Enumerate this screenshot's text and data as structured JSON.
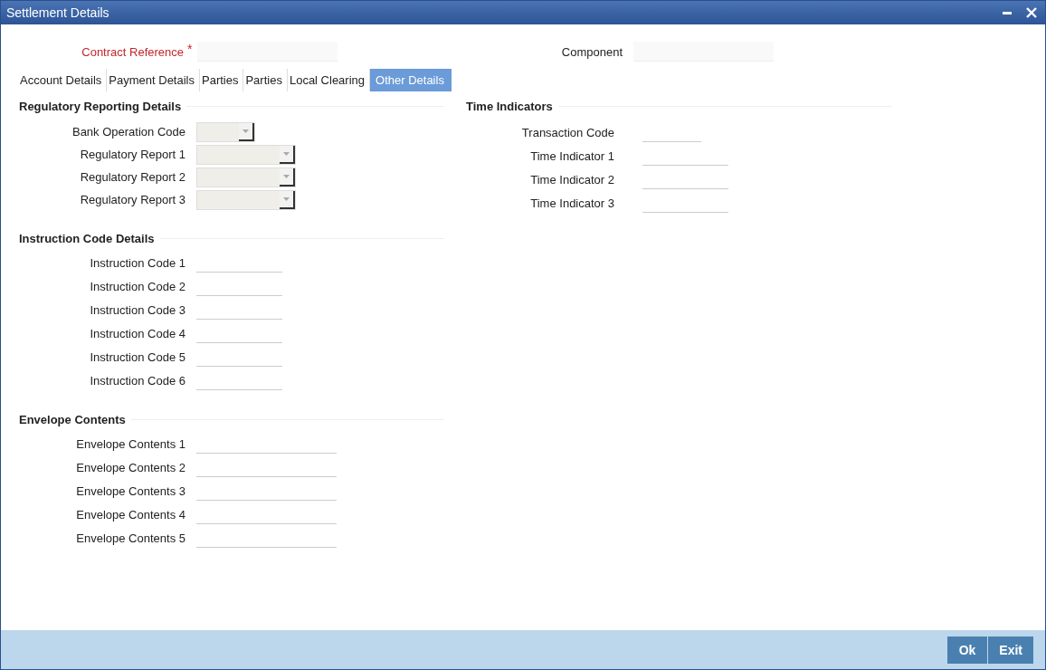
{
  "window": {
    "title": "Settlement Details"
  },
  "header": {
    "contract_reference": {
      "label": "Contract Reference",
      "required_mark": "*"
    },
    "component": {
      "label": "Component"
    }
  },
  "tabs": [
    {
      "label": "Account Details",
      "selected": false
    },
    {
      "label": "Payment Details",
      "selected": false
    },
    {
      "label": "Parties",
      "selected": false
    },
    {
      "label": "Parties",
      "selected": false
    },
    {
      "label": "Local Clearing",
      "selected": false
    },
    {
      "label": "Other Details",
      "selected": true
    }
  ],
  "left_sections": [
    {
      "title": "Regulatory Reporting Details",
      "fields": [
        {
          "label": "Bank Operation Code",
          "kind": "select"
        },
        {
          "label": "Regulatory Report 1",
          "kind": "select"
        },
        {
          "label": "Regulatory Report 2",
          "kind": "select"
        },
        {
          "label": "Regulatory Report 3",
          "kind": "select"
        }
      ]
    },
    {
      "title": "Instruction Code Details",
      "fields": [
        {
          "label": "Instruction Code 1",
          "kind": "text"
        },
        {
          "label": "Instruction Code 2",
          "kind": "text"
        },
        {
          "label": "Instruction Code 3",
          "kind": "text"
        },
        {
          "label": "Instruction Code 4",
          "kind": "text"
        },
        {
          "label": "Instruction Code 5",
          "kind": "text"
        },
        {
          "label": "Instruction Code 6",
          "kind": "text"
        }
      ]
    },
    {
      "title": "Envelope Contents",
      "fields": [
        {
          "label": "Envelope Contents 1",
          "kind": "text"
        },
        {
          "label": "Envelope Contents 2",
          "kind": "text"
        },
        {
          "label": "Envelope Contents 3",
          "kind": "text"
        },
        {
          "label": "Envelope Contents 4",
          "kind": "text"
        },
        {
          "label": "Envelope Contents 5",
          "kind": "text"
        }
      ]
    }
  ],
  "right_section": {
    "title": "Time Indicators",
    "fields": [
      {
        "label": "Transaction Code",
        "kind": "text"
      },
      {
        "label": "Time Indicator 1",
        "kind": "text"
      },
      {
        "label": "Time Indicator 2",
        "kind": "text"
      },
      {
        "label": "Time Indicator 3",
        "kind": "text"
      }
    ]
  },
  "buttons": [
    {
      "label": "Ok"
    },
    {
      "label": "Exit"
    }
  ]
}
